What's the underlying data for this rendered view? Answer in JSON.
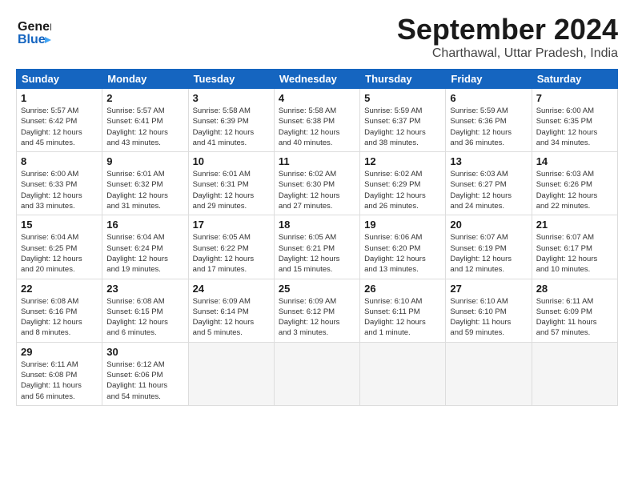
{
  "header": {
    "logo_general": "General",
    "logo_blue": "Blue",
    "title": "September 2024",
    "subtitle": "Charthawal, Uttar Pradesh, India"
  },
  "weekdays": [
    "Sunday",
    "Monday",
    "Tuesday",
    "Wednesday",
    "Thursday",
    "Friday",
    "Saturday"
  ],
  "weeks": [
    [
      {
        "day": "1",
        "info": "Sunrise: 5:57 AM\nSunset: 6:42 PM\nDaylight: 12 hours\nand 45 minutes."
      },
      {
        "day": "2",
        "info": "Sunrise: 5:57 AM\nSunset: 6:41 PM\nDaylight: 12 hours\nand 43 minutes."
      },
      {
        "day": "3",
        "info": "Sunrise: 5:58 AM\nSunset: 6:39 PM\nDaylight: 12 hours\nand 41 minutes."
      },
      {
        "day": "4",
        "info": "Sunrise: 5:58 AM\nSunset: 6:38 PM\nDaylight: 12 hours\nand 40 minutes."
      },
      {
        "day": "5",
        "info": "Sunrise: 5:59 AM\nSunset: 6:37 PM\nDaylight: 12 hours\nand 38 minutes."
      },
      {
        "day": "6",
        "info": "Sunrise: 5:59 AM\nSunset: 6:36 PM\nDaylight: 12 hours\nand 36 minutes."
      },
      {
        "day": "7",
        "info": "Sunrise: 6:00 AM\nSunset: 6:35 PM\nDaylight: 12 hours\nand 34 minutes."
      }
    ],
    [
      {
        "day": "8",
        "info": "Sunrise: 6:00 AM\nSunset: 6:33 PM\nDaylight: 12 hours\nand 33 minutes."
      },
      {
        "day": "9",
        "info": "Sunrise: 6:01 AM\nSunset: 6:32 PM\nDaylight: 12 hours\nand 31 minutes."
      },
      {
        "day": "10",
        "info": "Sunrise: 6:01 AM\nSunset: 6:31 PM\nDaylight: 12 hours\nand 29 minutes."
      },
      {
        "day": "11",
        "info": "Sunrise: 6:02 AM\nSunset: 6:30 PM\nDaylight: 12 hours\nand 27 minutes."
      },
      {
        "day": "12",
        "info": "Sunrise: 6:02 AM\nSunset: 6:29 PM\nDaylight: 12 hours\nand 26 minutes."
      },
      {
        "day": "13",
        "info": "Sunrise: 6:03 AM\nSunset: 6:27 PM\nDaylight: 12 hours\nand 24 minutes."
      },
      {
        "day": "14",
        "info": "Sunrise: 6:03 AM\nSunset: 6:26 PM\nDaylight: 12 hours\nand 22 minutes."
      }
    ],
    [
      {
        "day": "15",
        "info": "Sunrise: 6:04 AM\nSunset: 6:25 PM\nDaylight: 12 hours\nand 20 minutes."
      },
      {
        "day": "16",
        "info": "Sunrise: 6:04 AM\nSunset: 6:24 PM\nDaylight: 12 hours\nand 19 minutes."
      },
      {
        "day": "17",
        "info": "Sunrise: 6:05 AM\nSunset: 6:22 PM\nDaylight: 12 hours\nand 17 minutes."
      },
      {
        "day": "18",
        "info": "Sunrise: 6:05 AM\nSunset: 6:21 PM\nDaylight: 12 hours\nand 15 minutes."
      },
      {
        "day": "19",
        "info": "Sunrise: 6:06 AM\nSunset: 6:20 PM\nDaylight: 12 hours\nand 13 minutes."
      },
      {
        "day": "20",
        "info": "Sunrise: 6:07 AM\nSunset: 6:19 PM\nDaylight: 12 hours\nand 12 minutes."
      },
      {
        "day": "21",
        "info": "Sunrise: 6:07 AM\nSunset: 6:17 PM\nDaylight: 12 hours\nand 10 minutes."
      }
    ],
    [
      {
        "day": "22",
        "info": "Sunrise: 6:08 AM\nSunset: 6:16 PM\nDaylight: 12 hours\nand 8 minutes."
      },
      {
        "day": "23",
        "info": "Sunrise: 6:08 AM\nSunset: 6:15 PM\nDaylight: 12 hours\nand 6 minutes."
      },
      {
        "day": "24",
        "info": "Sunrise: 6:09 AM\nSunset: 6:14 PM\nDaylight: 12 hours\nand 5 minutes."
      },
      {
        "day": "25",
        "info": "Sunrise: 6:09 AM\nSunset: 6:12 PM\nDaylight: 12 hours\nand 3 minutes."
      },
      {
        "day": "26",
        "info": "Sunrise: 6:10 AM\nSunset: 6:11 PM\nDaylight: 12 hours\nand 1 minute."
      },
      {
        "day": "27",
        "info": "Sunrise: 6:10 AM\nSunset: 6:10 PM\nDaylight: 11 hours\nand 59 minutes."
      },
      {
        "day": "28",
        "info": "Sunrise: 6:11 AM\nSunset: 6:09 PM\nDaylight: 11 hours\nand 57 minutes."
      }
    ],
    [
      {
        "day": "29",
        "info": "Sunrise: 6:11 AM\nSunset: 6:08 PM\nDaylight: 11 hours\nand 56 minutes."
      },
      {
        "day": "30",
        "info": "Sunrise: 6:12 AM\nSunset: 6:06 PM\nDaylight: 11 hours\nand 54 minutes."
      },
      null,
      null,
      null,
      null,
      null
    ]
  ]
}
